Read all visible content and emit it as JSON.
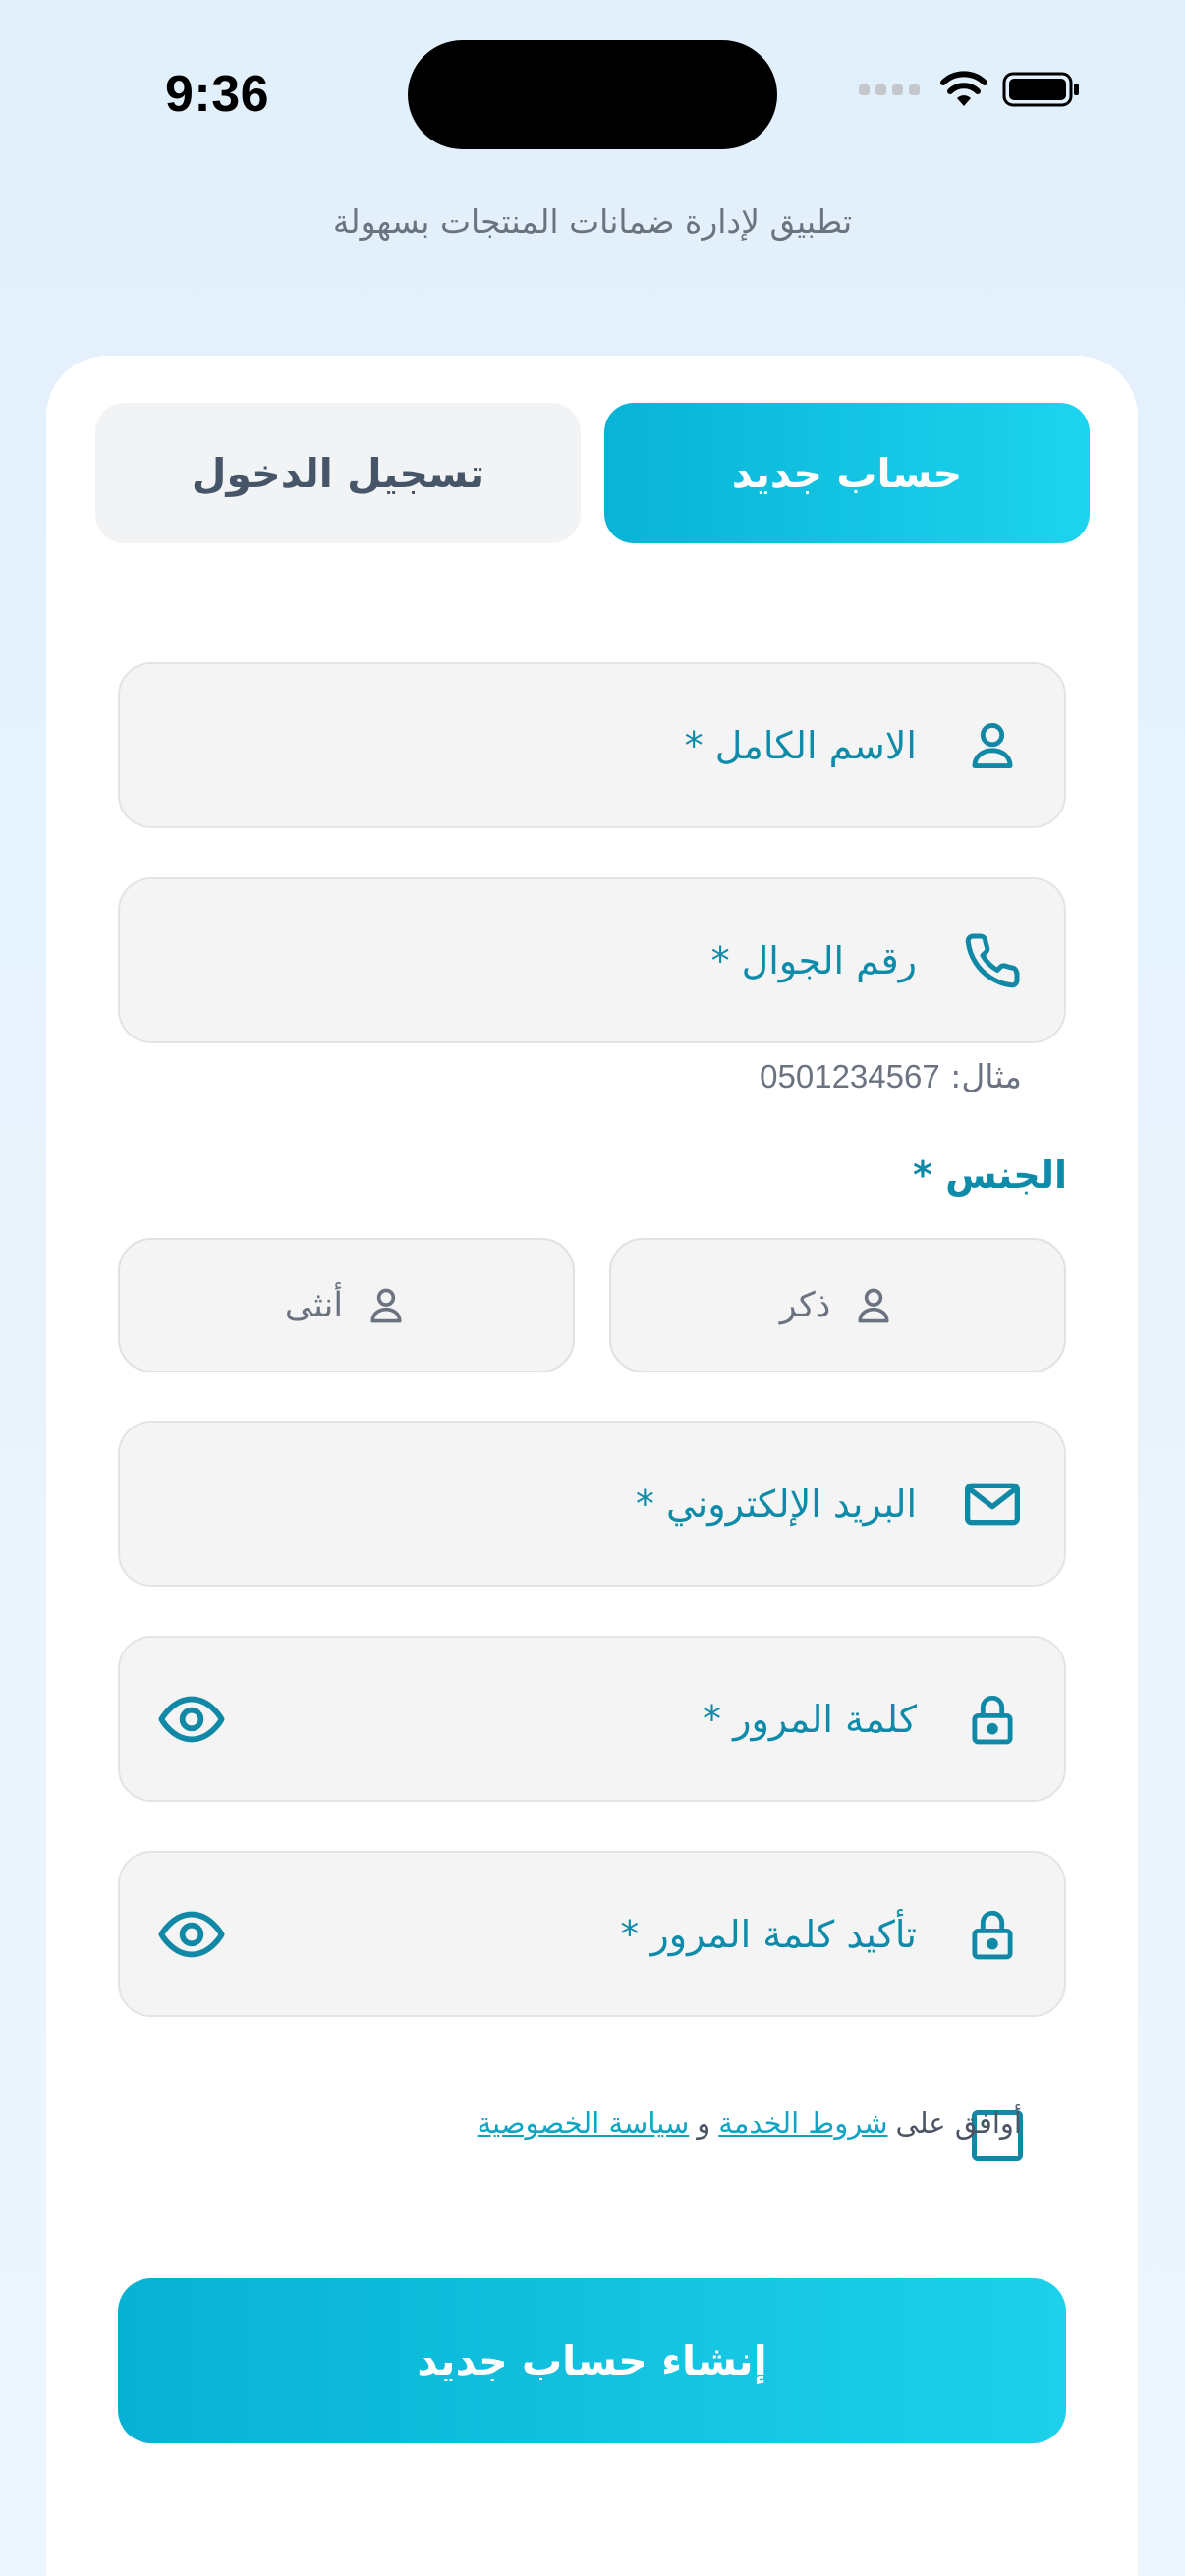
{
  "status_bar": {
    "time": "9:36"
  },
  "header": {
    "subtitle": "تطبيق لإدارة ضمانات المنتجات بسهولة"
  },
  "tabs": {
    "register_label": "حساب جديد",
    "login_label": "تسجيل الدخول"
  },
  "form": {
    "full_name_label": "الاسم الكامل *",
    "phone_label": "رقم الجوال *",
    "phone_hint_prefix": "مثال:",
    "phone_hint_number": "0501234567",
    "gender_label": "الجنس *",
    "gender_male": "ذكر",
    "gender_female": "أنثى",
    "email_label": "البريد الإلكتروني *",
    "password_label": "كلمة المرور *",
    "confirm_password_label": "تأكيد كلمة المرور *"
  },
  "terms": {
    "prefix": "أوافق على",
    "terms_link": "شروط الخدمة",
    "conjunction": "و",
    "privacy_link": "سياسة الخصوصية",
    "checked": false
  },
  "submit": {
    "label": "إنشاء حساب جديد"
  },
  "colors": {
    "accent": "#0ab5d8",
    "label": "#0e8ba8",
    "field_bg": "#f4f4f5",
    "background": "#e2f0fc"
  },
  "icons": [
    "person-icon",
    "phone-icon",
    "mail-icon",
    "lock-icon",
    "eye-icon",
    "wifi-icon",
    "battery-icon"
  ]
}
